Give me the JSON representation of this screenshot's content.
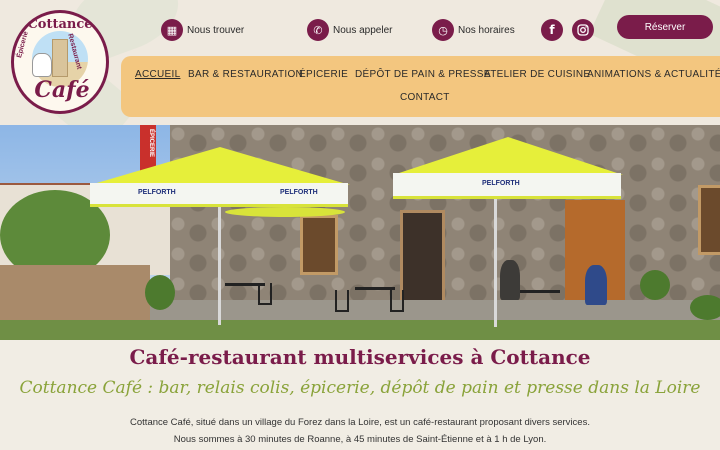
{
  "logo": {
    "name": "Cottance",
    "side_left": "Épicerie",
    "side_right": "Restaurant",
    "cafe": "Café"
  },
  "header": {
    "find_us": "Nous trouver",
    "call_us": "Nous appeler",
    "hours": "Nos horaires",
    "facebook": "f",
    "reserve": "Réserver"
  },
  "nav": {
    "items": [
      "ACCUEIL",
      "BAR & RESTAURATION",
      "ÉPICERIE",
      "DÉPÔT DE PAIN & PRESSE",
      "ATELIER DE CUISINE",
      "ANIMATIONS & ACTUALITÉS",
      "CONTACT"
    ],
    "active": "ACCUEIL"
  },
  "hero": {
    "sign_text": "ÉPICERIE",
    "umbrella_brand": "PELFORTH"
  },
  "content": {
    "title": "Café-restaurant multiservices à Cottance",
    "subtitle": "Cottance Café : bar, relais colis, épicerie, dépôt de pain et presse dans la Loire",
    "para1": "Cottance Café, situé dans un village du Forez dans la Loire, est un café-restaurant proposant divers services.",
    "para2": "Nous sommes à 30 minutes de Roanne, à 45 minutes de Saint-Étienne et à 1 h de Lyon."
  },
  "colors": {
    "brand": "#7a1c4a",
    "nav_bg": "#f3c67f",
    "accent_green": "#8aa33a",
    "page_bg": "#f1ede4"
  },
  "icons": {
    "find_us": "calendar-icon",
    "call_us": "phone-icon",
    "hours": "clock-icon",
    "social_1": "facebook-icon",
    "social_2": "instagram-icon"
  }
}
